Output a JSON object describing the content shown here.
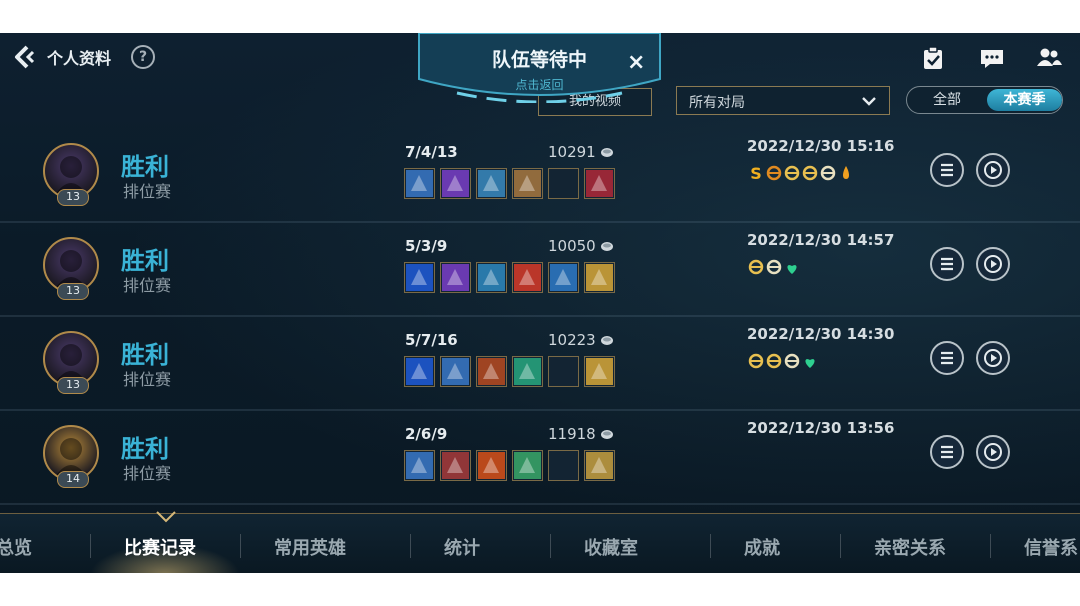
{
  "header": {
    "title": "个人资料",
    "help": "?"
  },
  "queue": {
    "title": "队伍等待中",
    "subtitle": "点击返回",
    "close": "×"
  },
  "filters": {
    "my_videos": "我的视频",
    "match_filter": "所有对局",
    "segment_all": "全部",
    "segment_season": "本赛季"
  },
  "matches": [
    {
      "result": "胜利",
      "mode": "排位赛",
      "level": "13",
      "kda": "7/4/13",
      "gold": "10291",
      "datetime": "2022/12/30 15:16",
      "badge_icons": [
        "s-rank",
        "crossed-swords",
        "shield-medal",
        "wings",
        "triple-kill",
        "drop"
      ]
    },
    {
      "result": "胜利",
      "mode": "排位赛",
      "level": "13",
      "kda": "5/3/9",
      "gold": "10050",
      "datetime": "2022/12/30 14:57",
      "badge_icons": [
        "wings",
        "triple-kill",
        "heart-plus"
      ]
    },
    {
      "result": "胜利",
      "mode": "排位赛",
      "level": "13",
      "kda": "5/7/16",
      "gold": "10223",
      "datetime": "2022/12/30 14:30",
      "badge_icons": [
        "shield-medal",
        "wings",
        "triple-kill",
        "heart-plus"
      ]
    },
    {
      "result": "胜利",
      "mode": "排位赛",
      "level": "14",
      "kda": "2/6/9",
      "gold": "11918",
      "datetime": "2022/12/30 13:56",
      "badge_icons": []
    }
  ],
  "tabs": [
    "总览",
    "比赛记录",
    "常用英雄",
    "统计",
    "收藏室",
    "成就",
    "亲密关系",
    "信誉系"
  ],
  "active_tab": "比赛记录",
  "colors": {
    "accent": "#3ab3d6",
    "gold_border": "#b08a4a",
    "win": "#3ab3d6"
  }
}
